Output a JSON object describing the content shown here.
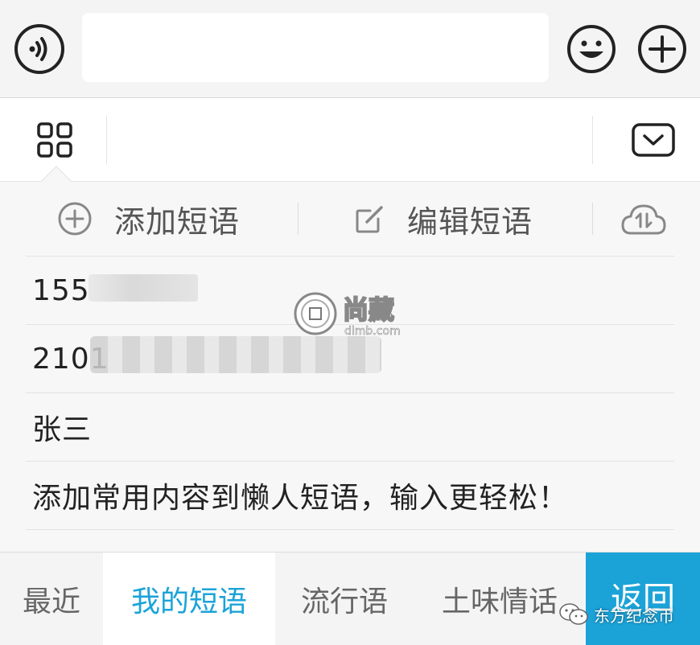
{
  "input_bar": {
    "voice_icon": "voice-input-icon",
    "text_value": "",
    "emoji_icon": "emoji-smile-icon",
    "plus_icon": "plus-circle-icon"
  },
  "toolbar": {
    "grid_icon": "grid-menu-icon",
    "collapse_icon": "keyboard-collapse-icon"
  },
  "phrases": {
    "add_label": "添加短语",
    "edit_label": "编辑短语",
    "sync_icon": "cloud-sync-icon",
    "items": [
      "155",
      "2101",
      "张三",
      "添加常用内容到懒人短语，输入更轻松！"
    ]
  },
  "watermark": {
    "name": "尚藏",
    "url": "dlmb.com"
  },
  "tabs": [
    {
      "label": "最近"
    },
    {
      "label": "我的短语"
    },
    {
      "label": "流行语"
    },
    {
      "label": "土味情话"
    }
  ],
  "back_label": "返回",
  "source_label": "东方纪念币",
  "colors": {
    "accent": "#1ba3d8",
    "panel": "#f7f7f7",
    "bar": "#f4f4f4"
  }
}
